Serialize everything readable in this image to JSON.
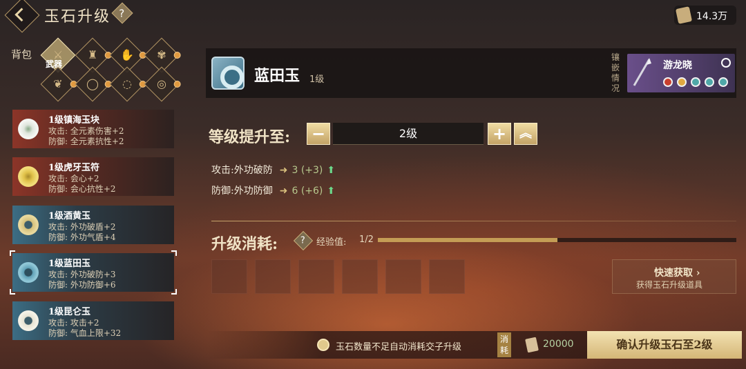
{
  "header": {
    "title": "玉石升级",
    "help_glyph": "?",
    "currency_value": "14.3万",
    "currency_icon": "scroll-icon"
  },
  "categories": {
    "bag_label": "背包",
    "selected_label": "武器",
    "row1": [
      "武器",
      "衣服",
      "护腕",
      "腰带"
    ],
    "row2": [
      "鞋子",
      "戒指",
      "项链",
      "玉佩"
    ]
  },
  "gems": [
    {
      "name": "1级镇海玉块",
      "line1": "攻击: 全元素伤害+2",
      "line2": "防御: 全元素抗性+2",
      "style": "red",
      "color": "#dfe6dd"
    },
    {
      "name": "1级虎牙玉符",
      "line1": "攻击: 会心+2",
      "line2": "防御: 会心抗性+2",
      "style": "red",
      "color": "#e1c24a"
    },
    {
      "name": "1级酒黄玉",
      "line1": "攻击: 外功破盾+2",
      "line2": "防御: 外功气盾+4",
      "style": "blue",
      "color": "#d4c07a"
    },
    {
      "name": "1级蓝田玉",
      "line1": "攻击: 外功破防+3",
      "line2": "防御: 外功防御+6",
      "style": "blue",
      "color": "#5fa0b6"
    },
    {
      "name": "1级昆仑玉",
      "line1": "攻击: 攻击+2",
      "line2": "防御: 气血上限+32",
      "style": "blue",
      "color": "#e6e2d2"
    }
  ],
  "selected_gem": {
    "name": "蓝田玉",
    "level": "1级"
  },
  "inlay": {
    "label": "镶嵌情况",
    "equip_name": "游龙晓",
    "slot_colors": [
      "#c93f2e",
      "#e0a840",
      "#4fa8a8",
      "#4fa8a8",
      "#4fa8a8"
    ]
  },
  "upgrade": {
    "label": "等级提升至:",
    "minus": "−",
    "value": "2级",
    "plus": "+",
    "max": "︽"
  },
  "stats": [
    {
      "label": "攻击:外功破防",
      "value": "3",
      "delta": "(+3)"
    },
    {
      "label": "防御:外功防御",
      "value": "6",
      "delta": "(+6)"
    }
  ],
  "cost": {
    "label": "升级消耗:",
    "exp_label": "经验值:",
    "exp_value": "1/2",
    "exp_fraction": 0.5
  },
  "quick_get": {
    "title": "快速获取",
    "subtitle": "获得玉石升级道具"
  },
  "bottom": {
    "auto_label": "玉石数量不足自动消耗交子升级",
    "cost_tag": "消耗",
    "coin_value": "20000",
    "confirm_label": "确认升级玉石至2级"
  }
}
